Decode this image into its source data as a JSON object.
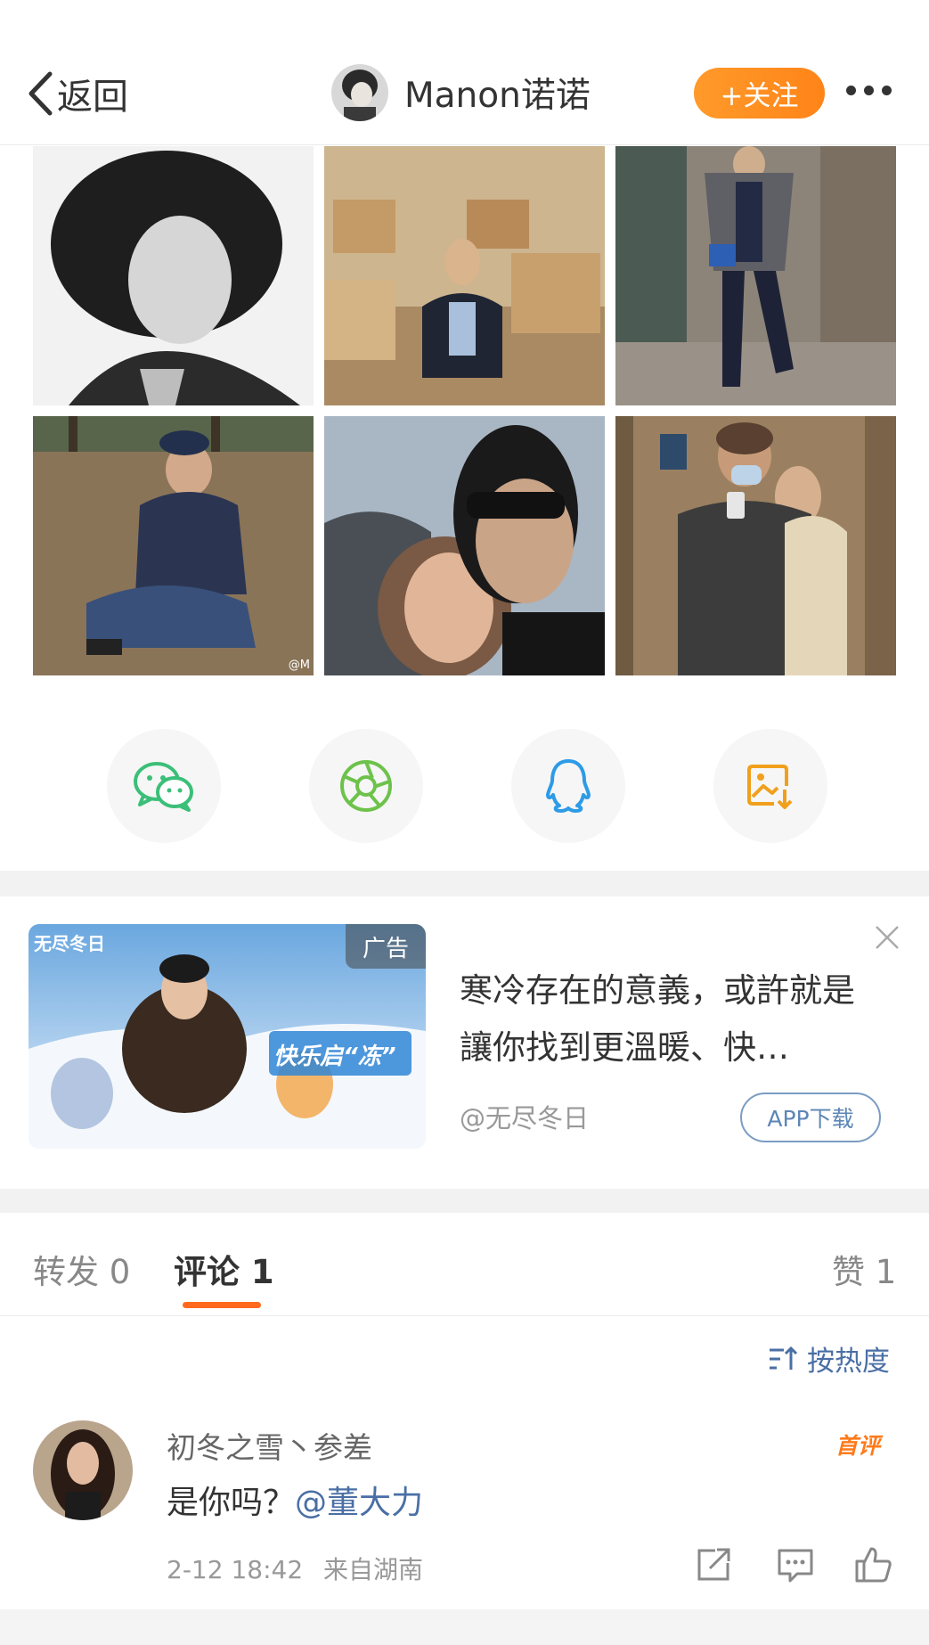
{
  "header": {
    "back_label": "返回",
    "user_name": "Manon诺诺",
    "follow_label": "+关注"
  },
  "photos": {
    "watermark": "@M"
  },
  "ad": {
    "tag": "广告",
    "image_title": "无尽冬日",
    "image_slogan": "快乐启“冻”",
    "text": "寒冷存在的意義，或許就是讓你找到更溫暖、快…",
    "source": "@无尽冬日",
    "app_button": "APP下载"
  },
  "tabs": {
    "repost": "转发 0",
    "comment": "评论 1",
    "like": "赞 1"
  },
  "sort": {
    "label": "按热度"
  },
  "comment": {
    "user": "初冬之雪丶参差",
    "badge": "首评",
    "text": "是你吗？",
    "mention": "@董大力",
    "time": "2-12 18:42",
    "location": "来自湖南"
  },
  "colors": {
    "accent": "#ff8418",
    "link": "#4a6fa5",
    "tab_underline": "#ff6a1f"
  },
  "icons": [
    "chevron-left-icon",
    "more-icon",
    "wechat-icon",
    "moments-icon",
    "qq-icon",
    "save-image-icon",
    "close-icon",
    "sort-icon",
    "share-icon",
    "comment-icon",
    "like-icon"
  ]
}
